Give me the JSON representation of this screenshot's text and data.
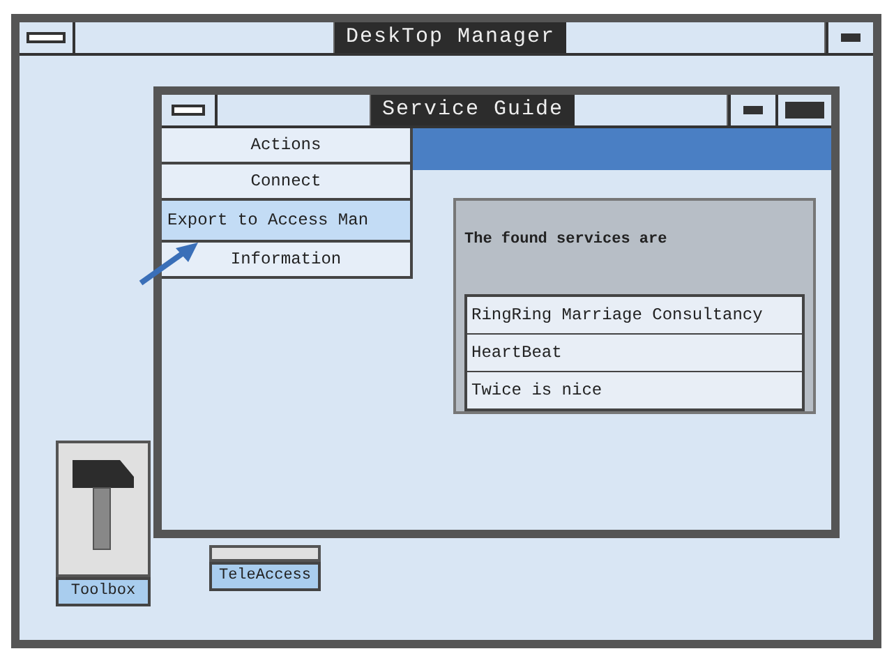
{
  "desktop_window": {
    "title": "DeskTop Manager"
  },
  "desktop_icons": [
    {
      "label": "Toolbox",
      "kind": "toolbox"
    },
    {
      "label": "TeleAccess",
      "kind": "hidden"
    }
  ],
  "service_window": {
    "title": "Service Guide",
    "menu": [
      {
        "label": "Actions",
        "selected": false
      },
      {
        "label": "Connect",
        "selected": false
      },
      {
        "label": "Export to Access Man",
        "selected": true
      },
      {
        "label": "Information",
        "selected": false
      }
    ],
    "panel": {
      "heading": "The found services are",
      "services": [
        {
          "label": "RingRing Marriage Consultancy"
        },
        {
          "label": "HeartBeat"
        },
        {
          "label": "Twice is nice"
        }
      ]
    }
  }
}
